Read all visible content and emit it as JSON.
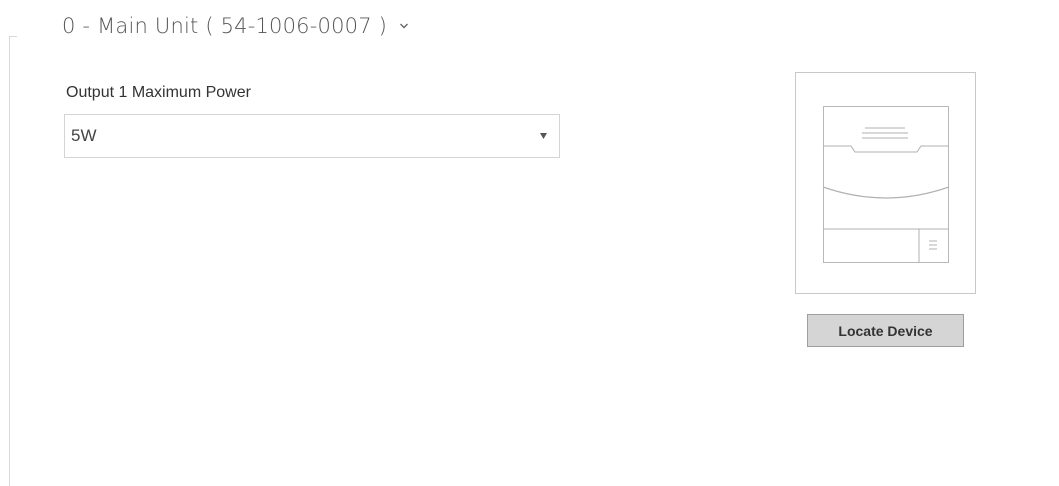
{
  "module": {
    "title": "0 - Main Unit ( 54-1006-0007 )",
    "expand_icon": "chevron-down-icon"
  },
  "settings": {
    "output_power_label": "Output 1 Maximum Power",
    "output_power_value": "5W",
    "dropdown_icon": "caret-down-icon"
  },
  "device_preview": {
    "icon": "intercom-module-icon",
    "locate_button_label": "Locate Device"
  },
  "colors": {
    "button_bg": "#d5d5d5",
    "button_border": "#9f9f9f",
    "frame_border": "#c8c8c8",
    "text": "#333333"
  }
}
